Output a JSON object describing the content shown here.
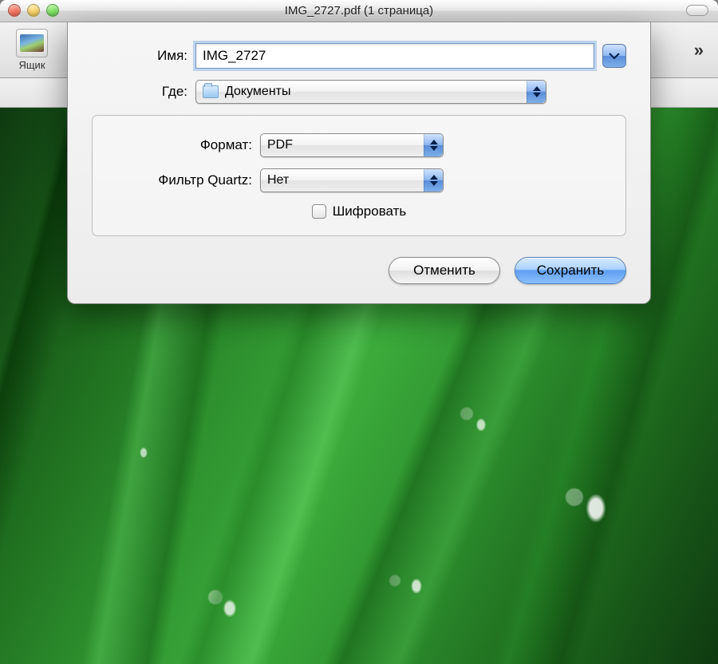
{
  "window": {
    "title": "IMG_2727.pdf (1 страница)"
  },
  "toolbar": {
    "drawer_label": "Ящик",
    "overflow_glyph": "»"
  },
  "sheet": {
    "name_label": "Имя:",
    "name_value": "IMG_2727",
    "where_label": "Где:",
    "where_value": "Документы",
    "format_label": "Формат:",
    "format_value": "PDF",
    "quartz_label": "Фильтр Quartz:",
    "quartz_value": "Нет",
    "encrypt_label": "Шифровать",
    "cancel_label": "Отменить",
    "save_label": "Сохранить"
  }
}
